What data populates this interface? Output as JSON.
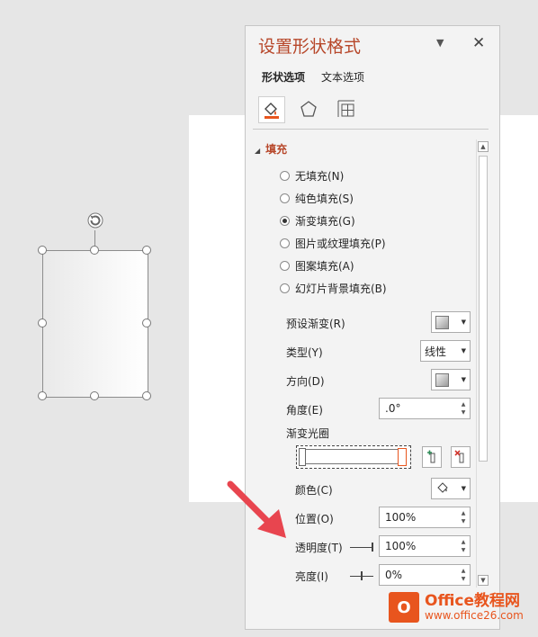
{
  "panel": {
    "title": "设置形状格式",
    "tabs": [
      "形状选项",
      "文本选项"
    ],
    "section_title": "填充",
    "fill_options": [
      {
        "label": "无填充(N)",
        "selected": false
      },
      {
        "label": "纯色填充(S)",
        "selected": false
      },
      {
        "label": "渐变填充(G)",
        "selected": true
      },
      {
        "label": "图片或纹理填充(P)",
        "selected": false
      },
      {
        "label": "图案填充(A)",
        "selected": false
      },
      {
        "label": "幻灯片背景填充(B)",
        "selected": false
      }
    ],
    "fields": {
      "preset_label": "预设渐变(R)",
      "type_label": "类型(Y)",
      "type_value": "线性",
      "direction_label": "方向(D)",
      "angle_label": "角度(E)",
      "angle_value": ".0°",
      "stops_label": "渐变光圈",
      "color_label": "颜色(C)",
      "position_label": "位置(O)",
      "position_value": "100%",
      "transparency_label": "透明度(T)",
      "transparency_value": "100%",
      "brightness_label": "亮度(I)",
      "brightness_value": "0%"
    }
  },
  "watermark": {
    "logo_letter": "O",
    "line1": "Office教程网",
    "line2": "www.office26.com"
  },
  "colors": {
    "accent": "#b7472a",
    "arrow": "#e8454f",
    "watermark": "#e8551e"
  }
}
